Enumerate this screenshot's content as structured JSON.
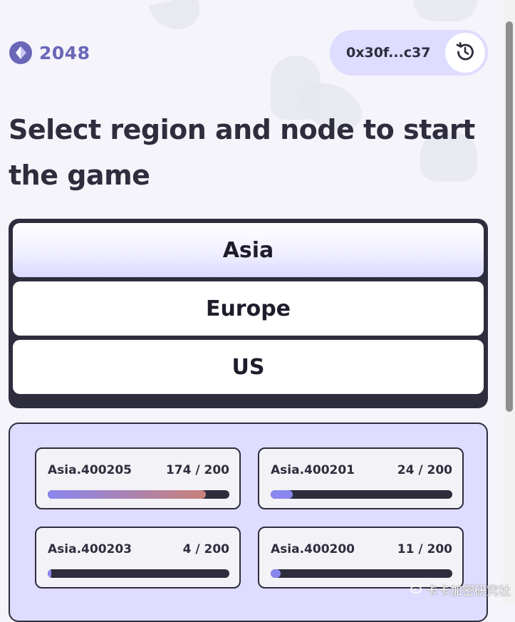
{
  "header": {
    "logo_text": "2048",
    "wallet_address": "0x30f...c37",
    "brand_color": "#6a66b8",
    "icons": {
      "logo": "play-diamond-icon",
      "reset": "refresh-icon"
    }
  },
  "title": "Select region and node to start the game",
  "regions": [
    {
      "label": "Asia",
      "selected": true
    },
    {
      "label": "Europe",
      "selected": false
    },
    {
      "label": "US",
      "selected": false
    }
  ],
  "nodes": [
    {
      "name": "Asia.400205",
      "count": "174 / 200",
      "fill": 0.87
    },
    {
      "name": "Asia.400201",
      "count": "24 / 200",
      "fill": 0.12
    },
    {
      "name": "Asia.400203",
      "count": "4 / 200",
      "fill": 0.02
    },
    {
      "name": "Asia.400200",
      "count": "11 / 200",
      "fill": 0.055
    }
  ],
  "watermark": "卡卡加密研究社",
  "colors": {
    "panel_dark": "#2e2d3d",
    "accent_light": "#dedcff",
    "progress": "#8a86f0"
  }
}
